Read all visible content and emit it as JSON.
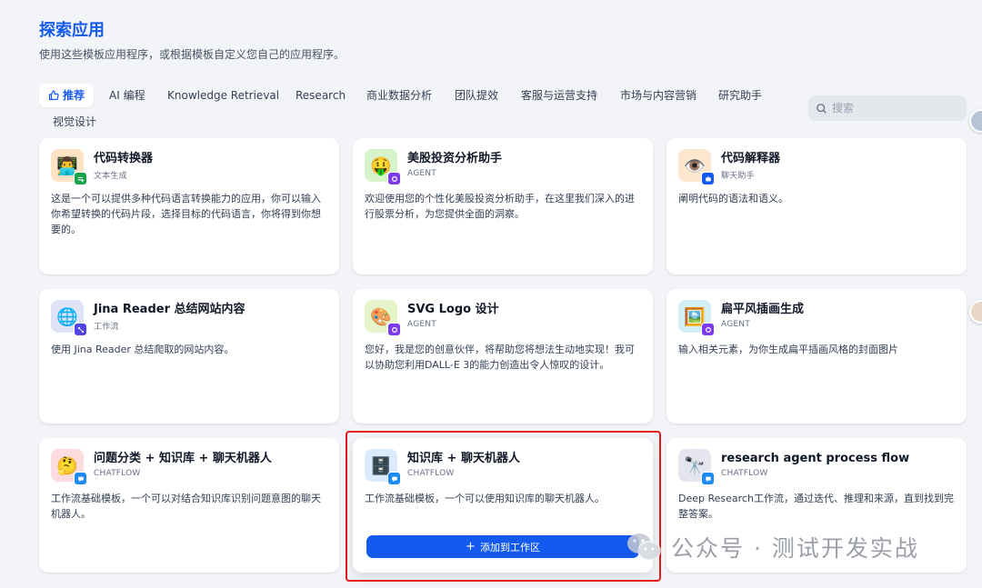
{
  "header": {
    "title": "探索应用",
    "subtitle": "使用这些模板应用程序，或根据模板自定义您自己的应用程序。"
  },
  "tabs": [
    {
      "label": "推荐",
      "active": true
    },
    {
      "label": "AI 编程"
    },
    {
      "label": "Knowledge Retrieval"
    },
    {
      "label": "Research"
    },
    {
      "label": "商业数据分析"
    },
    {
      "label": "团队提效"
    },
    {
      "label": "客服与运营支持"
    },
    {
      "label": "市场与内容营销"
    },
    {
      "label": "研究助手"
    },
    {
      "label": "视觉设计"
    }
  ],
  "search": {
    "placeholder": "搜索"
  },
  "cards": [
    {
      "name": "代码转换器",
      "type": "文本生成",
      "desc": "这是一个可以提供多种代码语言转换能力的应用，你可以输入你希望转换的代码片段，选择目标的代码语言，你将得到你想要的。",
      "icon": "technologist-emoji",
      "icon_bg": "#fde3c4",
      "badge_color": "#16a34a"
    },
    {
      "name": "美股投资分析助手",
      "type": "AGENT",
      "desc": "欢迎使用您的个性化美股投资分析助手，在这里我们深入的进行股票分析，为您提供全面的洞察。",
      "icon": "money-mouth-emoji",
      "icon_bg": "#d7f3c9",
      "badge_color": "#7c3aed"
    },
    {
      "name": "代码解释器",
      "type": "聊天助手",
      "desc": "阐明代码的语法和语义。",
      "icon": "eye-emoji",
      "icon_bg": "#fde7cf",
      "badge_color": "#155aef"
    },
    {
      "name": "Jina Reader 总结网站内容",
      "type": "工作流",
      "desc": "使用 Jina Reader 总结爬取的网站内容。",
      "icon": "globe-emoji",
      "icon_bg": "#dfe3f5",
      "badge_color": "#4f46e5"
    },
    {
      "name": "SVG Logo 设计",
      "type": "AGENT",
      "desc": "您好，我是您的创意伙伴，将帮助您将想法生动地实现！我可以协助您利用DALL-E 3的能力创造出令人惊叹的设计。",
      "icon": "palette-emoji",
      "icon_bg": "#e6f4c9",
      "badge_color": "#7c3aed"
    },
    {
      "name": "扁平风插画生成",
      "type": "AGENT",
      "desc": "输入相关元素，为你生成扁平插画风格的封面图片",
      "icon": "framed-picture-emoji",
      "icon_bg": "#d2eef4",
      "badge_color": "#7c3aed"
    },
    {
      "name": "问题分类 + 知识库 + 聊天机器人",
      "type": "CHATFLOW",
      "desc": "工作流基础模板，一个可以对结合知识库识别问题意图的聊天机器人。",
      "icon": "thinking-face-emoji",
      "icon_bg": "#fcdcde",
      "badge_color": "#1d8bf1"
    },
    {
      "name": "知识库 + 聊天机器人",
      "type": "CHATFLOW",
      "desc": "工作流基础模板，一个可以使用知识库的聊天机器人。",
      "icon": "file-cabinet-emoji",
      "icon_bg": "#dbeafc",
      "badge_color": "#1d8bf1"
    },
    {
      "name": "research agent process flow",
      "type": "CHATFLOW",
      "desc": "Deep Research工作流，通过迭代、推理和来源，直到找到完整答案。",
      "icon": "telescope-emoji",
      "icon_bg": "#e4e5ef",
      "badge_color": "#1d8bf1"
    }
  ],
  "add_button": {
    "label": "添加到工作区"
  },
  "watermark": {
    "text": "公众号 · 测试开发实战"
  }
}
